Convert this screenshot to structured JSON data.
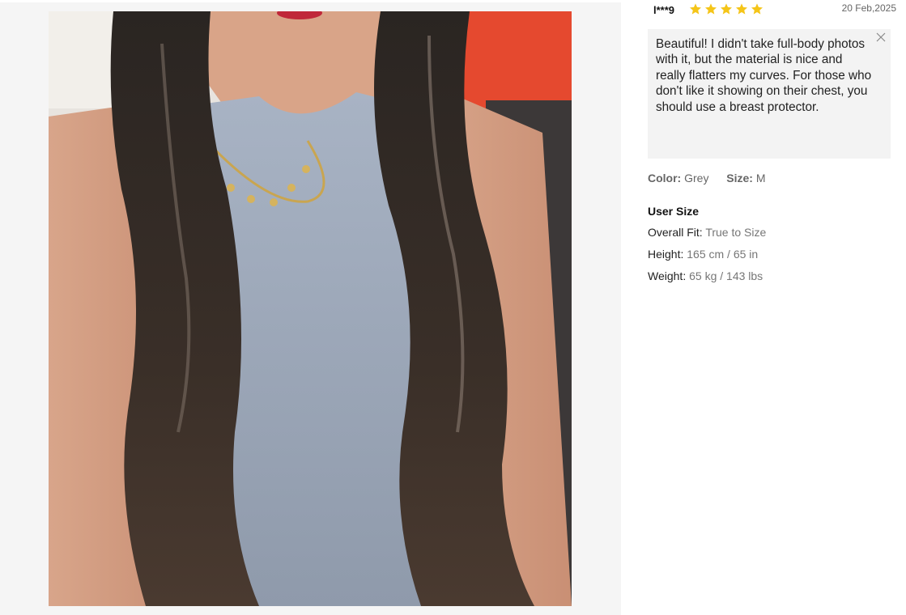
{
  "review": {
    "username": "l***9",
    "rating": 5,
    "star_color": "#f5c518",
    "date": "20 Feb,2025",
    "comment": "Beautiful! I didn't take full-body photos with it, but the material is nice and really flatters my curves. For those who don't like it showing on their chest, you should use a breast protector.",
    "close_icon": "close-icon",
    "color_label": "Color:",
    "color_value": "Grey",
    "size_label": "Size:",
    "size_value": "M",
    "user_size": {
      "title": "User Size",
      "overall_fit_label": "Overall Fit:",
      "overall_fit_value": "True to Size",
      "height_label": "Height:",
      "height_value": "165 cm / 65 in",
      "weight_label": "Weight:",
      "weight_value": "65 kg / 143 lbs"
    }
  }
}
